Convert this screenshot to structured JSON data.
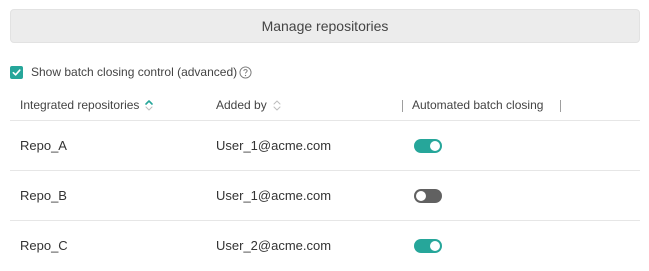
{
  "manage_button_label": "Manage repositories",
  "batch_control": {
    "label": "Show batch closing control (advanced)",
    "checked": true
  },
  "columns": [
    {
      "label": "Integrated repositories"
    },
    {
      "label": "Added by"
    },
    {
      "label": "Automated batch closing"
    }
  ],
  "rows": [
    {
      "repo": "Repo_A",
      "added_by": "User_1@acme.com",
      "auto_batch_closing": true
    },
    {
      "repo": "Repo_B",
      "added_by": "User_1@acme.com",
      "auto_batch_closing": false
    },
    {
      "repo": "Repo_C",
      "added_by": "User_2@acme.com",
      "auto_batch_closing": true
    }
  ],
  "colors": {
    "accent": "#26a69a",
    "toggle_off": "#616161",
    "button_bg": "#ececec",
    "divider": "#e6e6e6"
  },
  "icons": {
    "checkbox_check": "check-icon",
    "help": "question-circle-icon",
    "sort_active": "sort-up-icon",
    "sort_inactive": "sort-both-icon"
  }
}
